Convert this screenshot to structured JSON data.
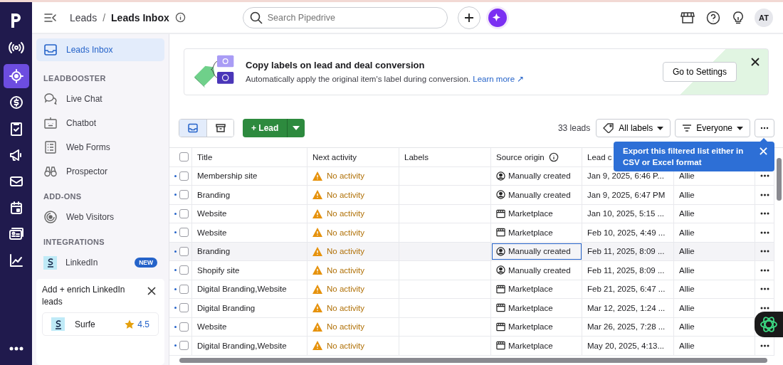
{
  "rail": [
    {
      "selected": false
    },
    {
      "selected": true
    },
    {
      "selected": false
    },
    {
      "selected": false
    },
    {
      "selected": false
    },
    {
      "selected": false
    },
    {
      "selected": false
    },
    {
      "selected": false
    },
    {
      "selected": false
    },
    {
      "selected": false
    }
  ],
  "breadcrumb": {
    "parent": "Leads",
    "separator": "/",
    "current": "Leads Inbox"
  },
  "search": {
    "placeholder": "Search Pipedrive"
  },
  "avatar": "AT",
  "sidebar": {
    "top": {
      "label": "Leads Inbox",
      "selected": true
    },
    "sections": [
      {
        "title": "LEADBOOSTER",
        "items": [
          {
            "label": "Live Chat"
          },
          {
            "label": "Chatbot"
          },
          {
            "label": "Web Forms"
          },
          {
            "label": "Prospector"
          }
        ]
      },
      {
        "title": "ADD-ONS",
        "items": [
          {
            "label": "Web Visitors"
          }
        ]
      },
      {
        "title": "INTEGRATIONS",
        "items": [
          {
            "label": "LinkedIn",
            "badge": "NEW"
          }
        ]
      }
    ],
    "promo": {
      "title": "Add + enrich LinkedIn leads",
      "app": "Surfe",
      "rating": "4.5"
    }
  },
  "banner": {
    "title": "Copy labels on lead and deal conversion",
    "text": "Automatically apply the original item's label during conversion.",
    "link": "Learn more ↗",
    "button": "Go to Settings"
  },
  "toolbar": {
    "views": [
      {
        "selected": true
      },
      {
        "selected": false
      }
    ],
    "add_button": "+ Lead",
    "count": "33 leads",
    "labels_filter": "All labels",
    "owner_filter": "Everyone"
  },
  "tooltip": "Export this filtered list either in CSV or Excel format",
  "table": {
    "select_all_checked": false,
    "columns": [
      "Title",
      "Next activity",
      "Labels",
      "Source origin",
      "Lead c"
    ],
    "rows": [
      {
        "checked": false,
        "title": "Membership site",
        "activity": "No activity",
        "source": "Manually created",
        "kind": "manual",
        "created": "Jan 9, 2025, 6:46 P...",
        "owner": "Allie",
        "highlighted": false
      },
      {
        "checked": false,
        "title": "Branding",
        "activity": "No activity",
        "source": "Manually created",
        "kind": "manual",
        "created": "Jan 9, 2025, 6:47 PM",
        "owner": "Allie",
        "highlighted": false
      },
      {
        "checked": false,
        "title": "Website",
        "activity": "No activity",
        "source": "Marketplace",
        "kind": "marketplace",
        "created": "Jan 10, 2025, 5:15 ...",
        "owner": "Allie",
        "highlighted": false
      },
      {
        "checked": false,
        "title": "Website",
        "activity": "No activity",
        "source": "Marketplace",
        "kind": "marketplace",
        "created": "Feb 10, 2025, 4:49 ...",
        "owner": "Allie",
        "highlighted": false
      },
      {
        "checked": false,
        "title": "Branding",
        "activity": "No activity",
        "source": "Manually created",
        "kind": "manual",
        "created": "Feb 11, 2025, 8:09 ...",
        "owner": "Allie",
        "highlighted": true
      },
      {
        "checked": false,
        "title": "Shopify site",
        "activity": "No activity",
        "source": "Manually created",
        "kind": "manual",
        "created": "Feb 11, 2025, 8:09 ...",
        "owner": "Allie",
        "highlighted": false
      },
      {
        "checked": false,
        "title": "Digital Branding,Website",
        "activity": "No activity",
        "source": "Marketplace",
        "kind": "marketplace",
        "created": "Feb 21, 2025, 6:47 ...",
        "owner": "Allie",
        "highlighted": false
      },
      {
        "checked": false,
        "title": "Digital Branding",
        "activity": "No activity",
        "source": "Marketplace",
        "kind": "marketplace",
        "created": "Mar 12, 2025, 1:24 ...",
        "owner": "Allie",
        "highlighted": false
      },
      {
        "checked": false,
        "title": "Website",
        "activity": "No activity",
        "source": "Marketplace",
        "kind": "marketplace",
        "created": "Mar 26, 2025, 7:28 ...",
        "owner": "Allie",
        "highlighted": false
      },
      {
        "checked": false,
        "title": "Digital Branding,Website",
        "activity": "No activity",
        "source": "Marketplace",
        "kind": "marketplace",
        "created": "May 20, 2025, 4:13...",
        "owner": "Allie",
        "highlighted": false
      }
    ]
  }
}
